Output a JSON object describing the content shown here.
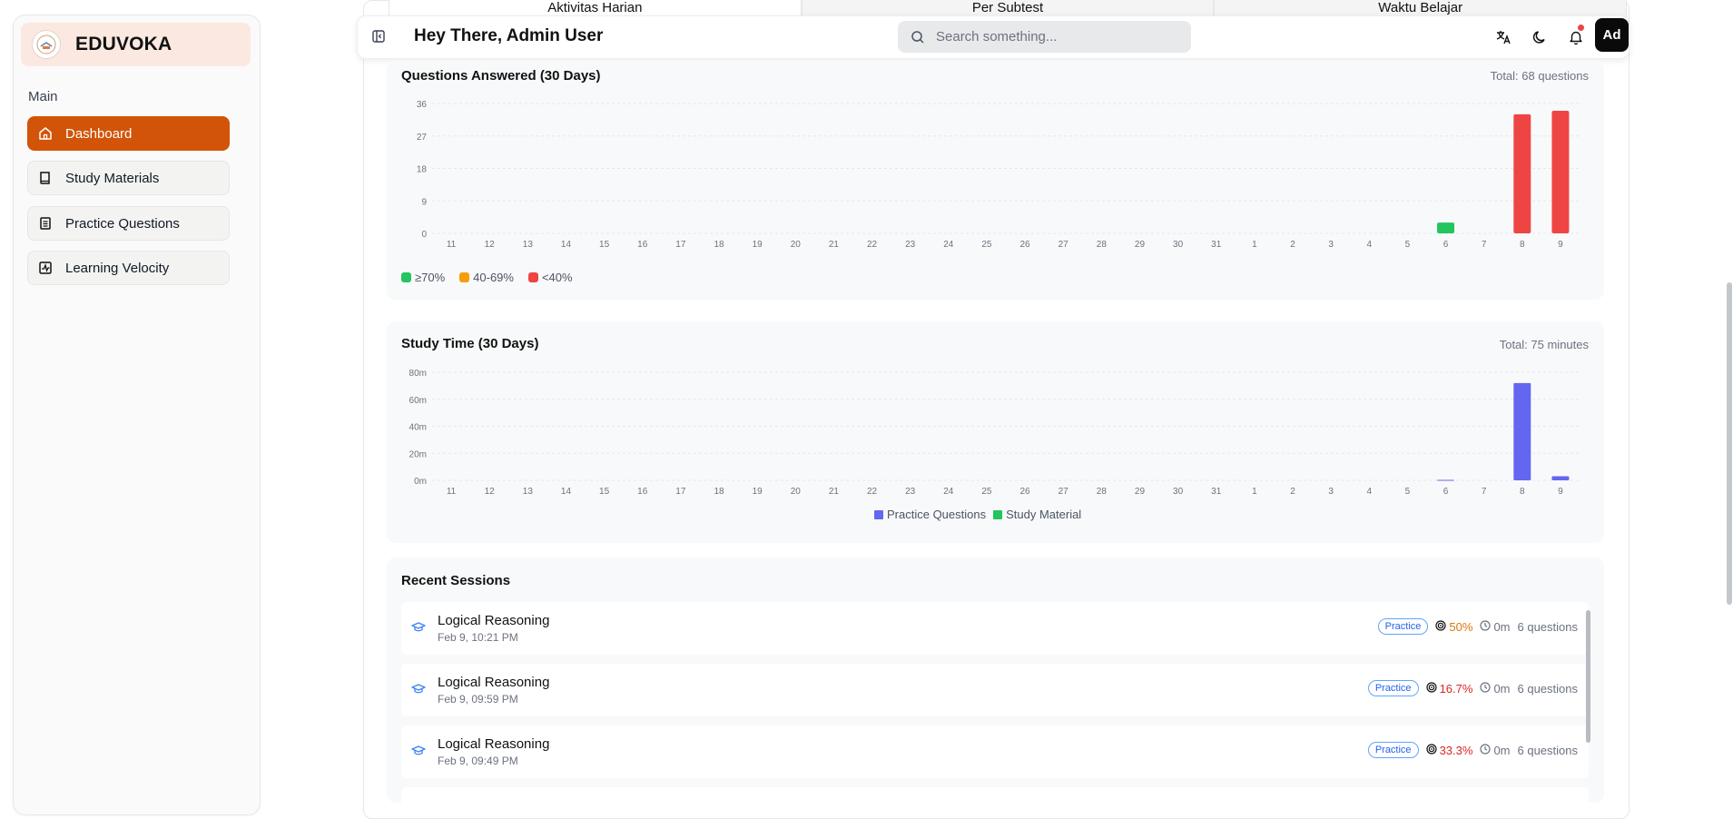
{
  "brand": {
    "name": "EDUVOKA"
  },
  "sidebar": {
    "section_label": "Main",
    "items": [
      {
        "label": "Dashboard",
        "icon": "home-icon",
        "active": true
      },
      {
        "label": "Study Materials",
        "icon": "book-icon"
      },
      {
        "label": "Practice Questions",
        "icon": "clipboard-icon"
      },
      {
        "label": "Learning Velocity",
        "icon": "activity-icon"
      }
    ]
  },
  "tabs": [
    "Aktivitas Harian",
    "Per Subtest",
    "Waktu Belajar"
  ],
  "header": {
    "greeting": "Hey There, Admin User",
    "search_placeholder": "Search something...",
    "avatar_initials": "Ad"
  },
  "questions_chart": {
    "title": "Questions Answered (30 Days)",
    "total": "Total: 68 questions",
    "legend": [
      {
        "label": "≥70%",
        "color": "#22c55e"
      },
      {
        "label": "40-69%",
        "color": "#f59e0b"
      },
      {
        "label": "<40%",
        "color": "#ef4444"
      }
    ]
  },
  "study_chart": {
    "title": "Study Time (30 Days)",
    "total": "Total: 75 minutes",
    "legend": [
      {
        "label": "Practice Questions",
        "color": "#6366f1"
      },
      {
        "label": "Study Material",
        "color": "#22c55e"
      }
    ]
  },
  "recent_sessions": {
    "title": "Recent Sessions",
    "items": [
      {
        "name": "Logical Reasoning",
        "date": "Feb 9, 10:21 PM",
        "badge": "Practice",
        "score": "50%",
        "score_color": "#d97706",
        "time": "0m",
        "questions": "6 questions"
      },
      {
        "name": "Logical Reasoning",
        "date": "Feb 9, 09:59 PM",
        "badge": "Practice",
        "score": "16.7%",
        "score_color": "#dc2626",
        "time": "0m",
        "questions": "6 questions"
      },
      {
        "name": "Logical Reasoning",
        "date": "Feb 9, 09:49 PM",
        "badge": "Practice",
        "score": "33.3%",
        "score_color": "#dc2626",
        "time": "0m",
        "questions": "6 questions"
      }
    ]
  },
  "chart_data": [
    {
      "type": "bar",
      "title": "Questions Answered (30 Days)",
      "categories": [
        "11",
        "12",
        "13",
        "14",
        "15",
        "16",
        "17",
        "18",
        "19",
        "20",
        "21",
        "22",
        "23",
        "24",
        "25",
        "26",
        "27",
        "28",
        "29",
        "30",
        "31",
        "1",
        "2",
        "3",
        "4",
        "5",
        "6",
        "7",
        "8",
        "9"
      ],
      "yticks": [
        "0",
        "9",
        "18",
        "27",
        "36"
      ],
      "ylim": [
        0,
        36
      ],
      "grid": true,
      "legend_position": "bottom-left",
      "values": [
        0,
        0,
        0,
        0,
        0,
        0,
        0,
        0,
        0,
        0,
        0,
        0,
        0,
        0,
        0,
        0,
        0,
        0,
        0,
        0,
        0,
        0,
        0,
        0,
        0,
        0,
        3,
        0,
        33,
        34
      ],
      "colors": [
        "#ef4444",
        "#ef4444",
        "#ef4444",
        "#ef4444",
        "#ef4444",
        "#ef4444",
        "#ef4444",
        "#ef4444",
        "#ef4444",
        "#ef4444",
        "#ef4444",
        "#ef4444",
        "#ef4444",
        "#ef4444",
        "#ef4444",
        "#ef4444",
        "#ef4444",
        "#ef4444",
        "#ef4444",
        "#ef4444",
        "#ef4444",
        "#ef4444",
        "#ef4444",
        "#ef4444",
        "#ef4444",
        "#ef4444",
        "#22c55e",
        "#ef4444",
        "#ef4444",
        "#ef4444"
      ]
    },
    {
      "type": "bar",
      "title": "Study Time (30 Days)",
      "categories": [
        "11",
        "12",
        "13",
        "14",
        "15",
        "16",
        "17",
        "18",
        "19",
        "20",
        "21",
        "22",
        "23",
        "24",
        "25",
        "26",
        "27",
        "28",
        "29",
        "30",
        "31",
        "1",
        "2",
        "3",
        "4",
        "5",
        "6",
        "7",
        "8",
        "9"
      ],
      "yticks": [
        "0m",
        "20m",
        "40m",
        "60m",
        "80m"
      ],
      "ylim": [
        0,
        80
      ],
      "grid": true,
      "legend_position": "bottom-center",
      "series": [
        {
          "name": "Practice Questions",
          "color": "#6366f1",
          "values": [
            0,
            0,
            0,
            0,
            0,
            0,
            0,
            0,
            0,
            0,
            0,
            0,
            0,
            0,
            0,
            0,
            0,
            0,
            0,
            0,
            0,
            0,
            0,
            0,
            0,
            0,
            0.3,
            0,
            72,
            3
          ]
        },
        {
          "name": "Study Material",
          "color": "#22c55e",
          "values": [
            0,
            0,
            0,
            0,
            0,
            0,
            0,
            0,
            0,
            0,
            0,
            0,
            0,
            0,
            0,
            0,
            0,
            0,
            0,
            0,
            0,
            0,
            0,
            0,
            0,
            0,
            0,
            0,
            0,
            0
          ]
        }
      ]
    }
  ]
}
